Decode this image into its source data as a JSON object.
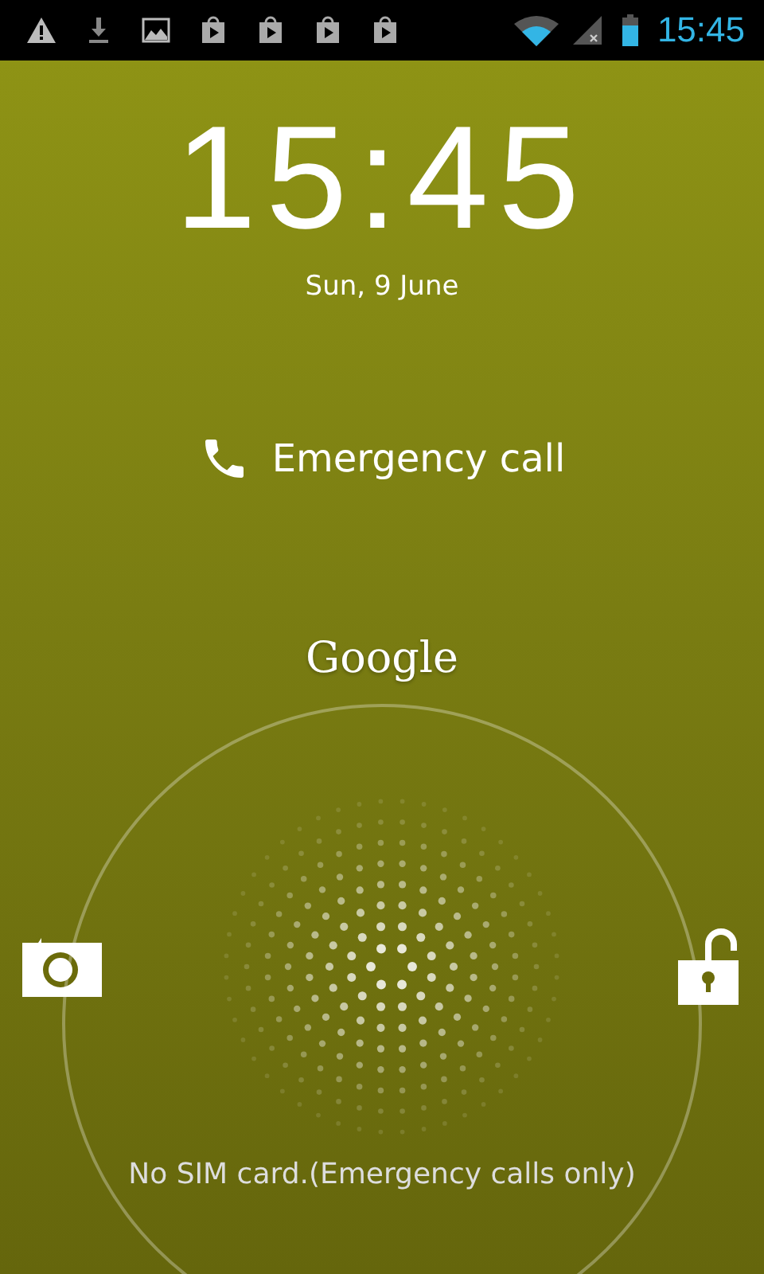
{
  "status_bar": {
    "time": "15:45"
  },
  "clock": {
    "time": "15:45",
    "date": "Sun, 9 June"
  },
  "emergency_call": {
    "label": "Emergency call"
  },
  "brand": "Google",
  "carrier_message": "No SIM card.(Emergency calls only)"
}
